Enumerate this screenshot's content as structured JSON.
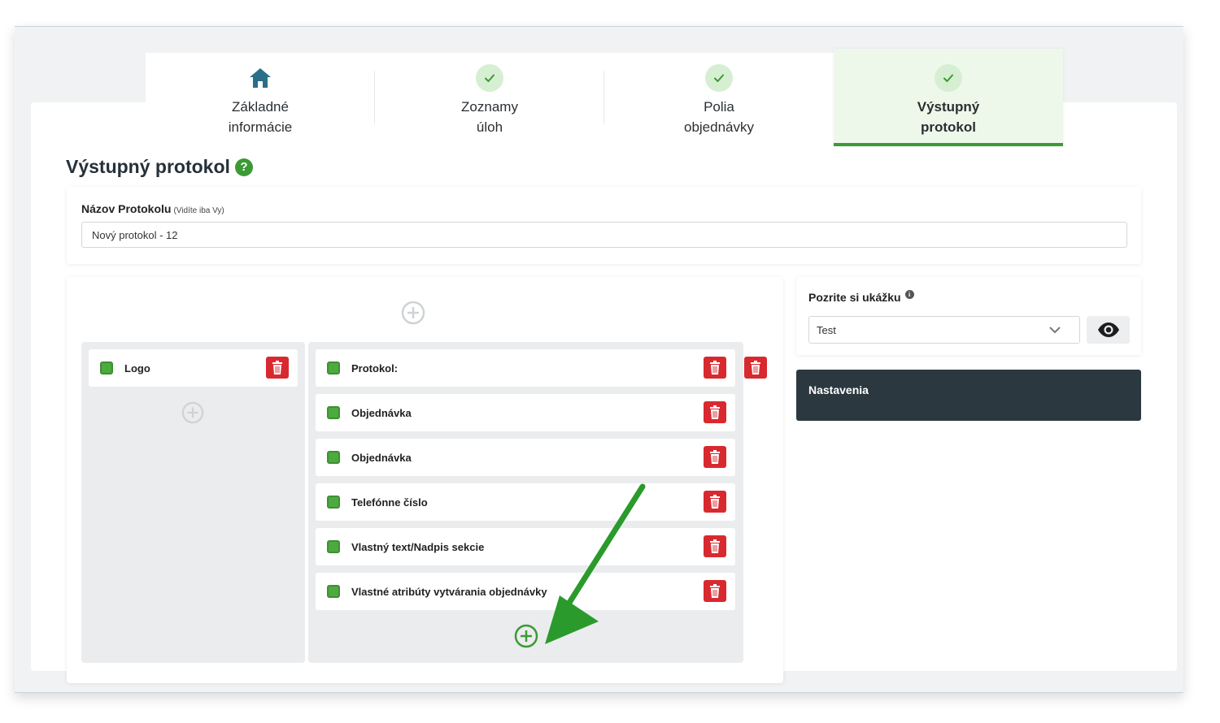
{
  "tabs": [
    {
      "label": "Základné\ninformácie",
      "icon": "home-icon",
      "state": "default"
    },
    {
      "label": "Zoznamy\núloh",
      "icon": "check-icon",
      "state": "done"
    },
    {
      "label": "Polia\nobjednávky",
      "icon": "check-icon",
      "state": "done"
    },
    {
      "label": "Výstupný\nprotokol",
      "icon": "check-icon",
      "state": "active"
    }
  ],
  "page": {
    "title": "Výstupný protokol",
    "help_icon": "?"
  },
  "name_card": {
    "label": "Názov Protokolu",
    "hint": "(Vidíte iba Vy)",
    "value": "Nový protokol - 12"
  },
  "builder": {
    "left_column": [
      {
        "label": "Logo"
      }
    ],
    "right_column": [
      {
        "label": "Protokol:"
      },
      {
        "label": "Objednávka"
      },
      {
        "label": "Objednávka"
      },
      {
        "label": "Telefónne číslo"
      },
      {
        "label": "Vlastný text/Nadpis sekcie"
      },
      {
        "label": "Vlastné atribúty vytvárania objednávky"
      }
    ]
  },
  "preview": {
    "label": "Pozrite si ukážku",
    "info_icon": "i",
    "selected": "Test"
  },
  "settings": {
    "label": "Nastavenia"
  },
  "colors": {
    "accent_green": "#3c9a35",
    "delete_red": "#d8292f",
    "dark_panel": "#2c383f",
    "home_icon": "#2a6f8a"
  }
}
